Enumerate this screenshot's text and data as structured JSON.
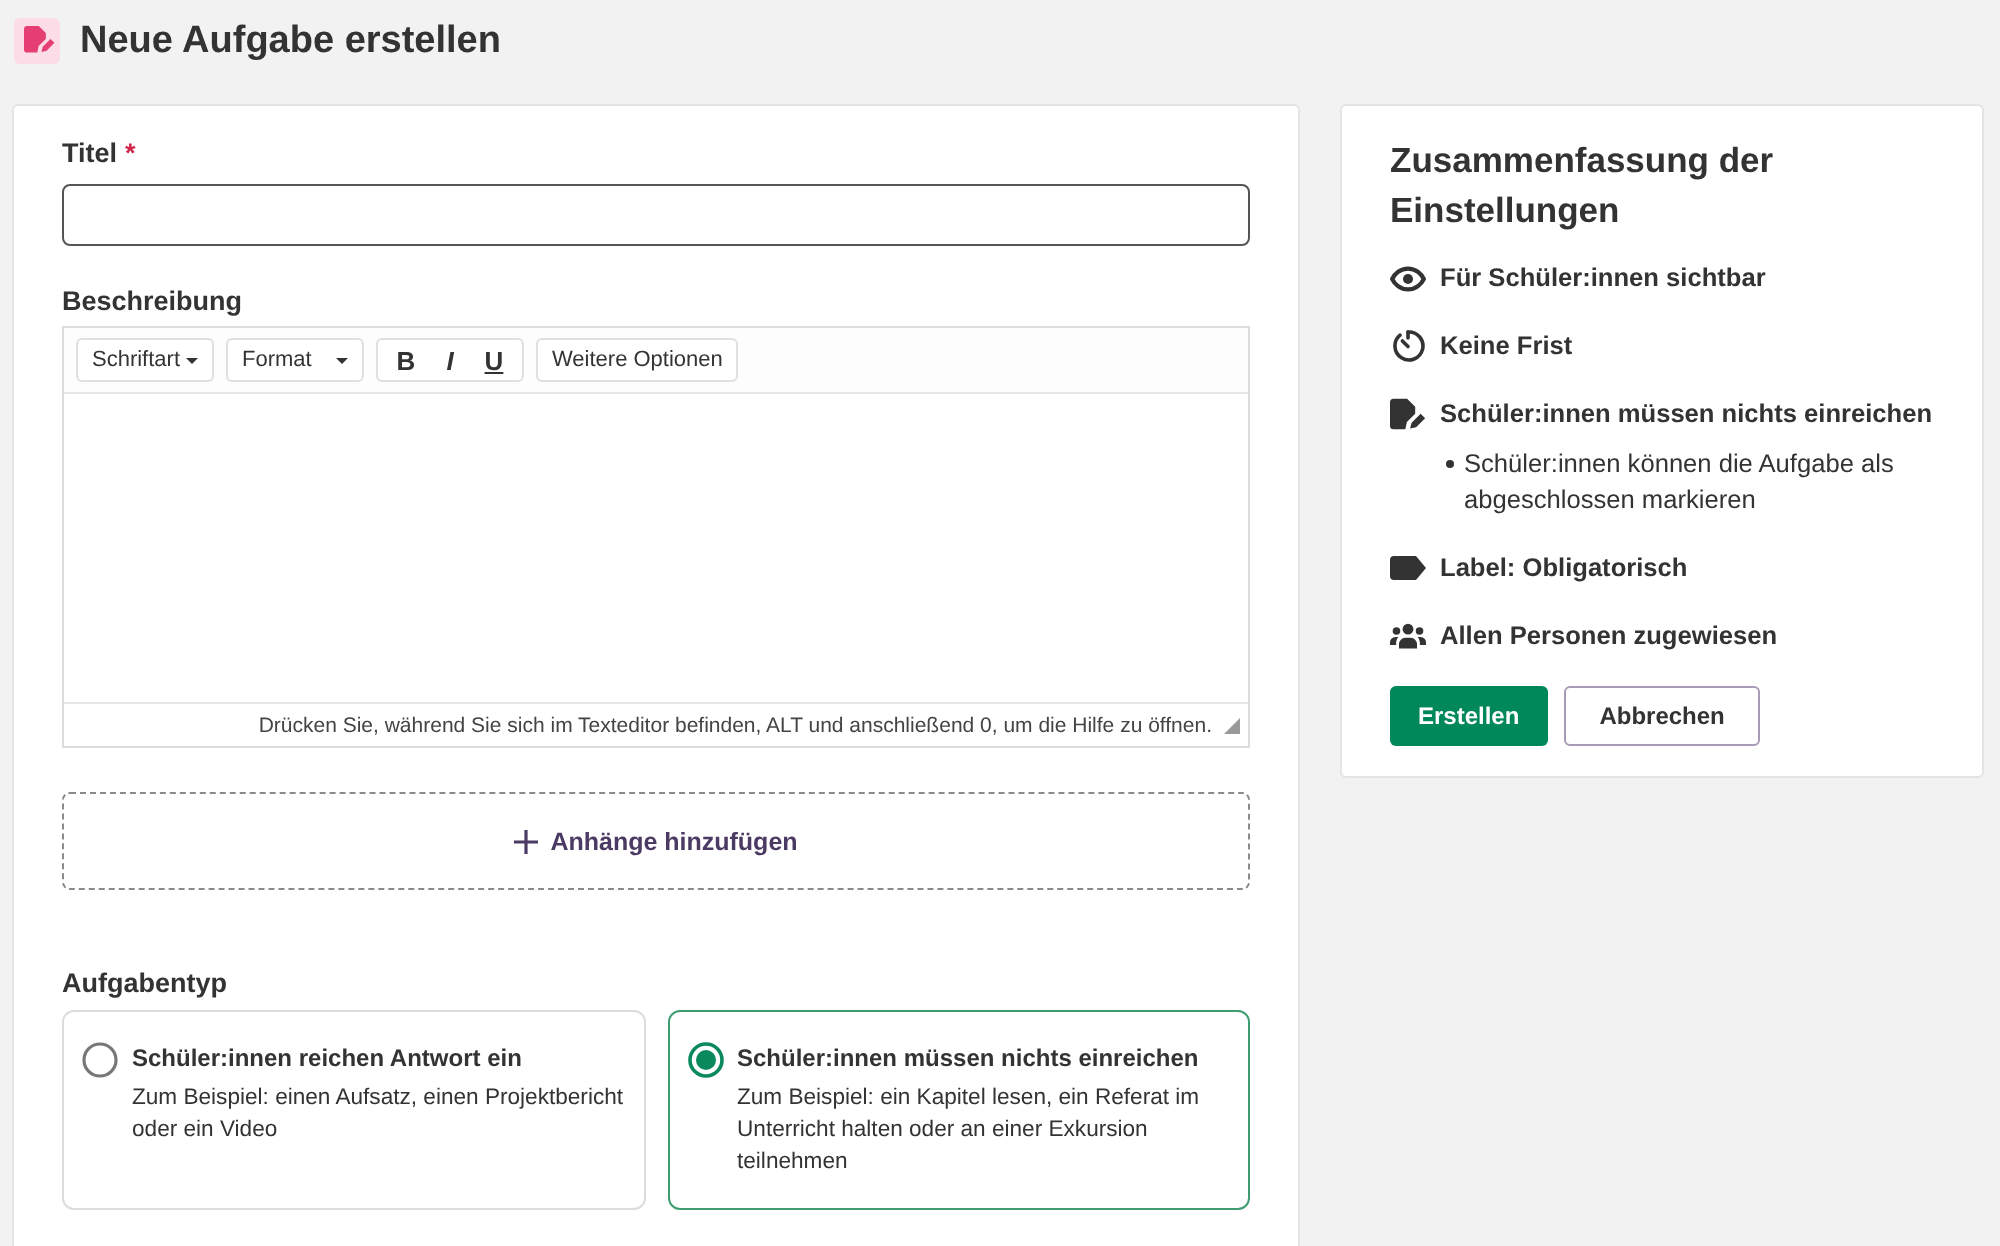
{
  "header": {
    "title": "Neue Aufgabe erstellen"
  },
  "form": {
    "title_field": {
      "label": "Titel",
      "required_mark": "*"
    },
    "description": {
      "label": "Beschreibung",
      "toolbar": [
        {
          "kind": "dropdown",
          "label": "Schriftart"
        },
        {
          "kind": "dropdown",
          "label": "Format"
        },
        {
          "kind": "group",
          "buttons": [
            {
              "kind": "bold",
              "label": "B"
            },
            {
              "kind": "italic",
              "label": "I"
            },
            {
              "kind": "underline",
              "label": "U"
            }
          ]
        },
        {
          "kind": "button",
          "label": "Weitere Optionen"
        }
      ],
      "help_text": "Drücken Sie, während Sie sich im Texteditor befinden, ALT und anschließend 0, um die Hilfe zu öffnen."
    },
    "attachments": {
      "label": "Anhänge hinzufügen"
    },
    "task_type": {
      "label": "Aufgabentyp",
      "options": [
        {
          "title": "Schüler:innen reichen Antwort ein",
          "description": "Zum Beispiel: einen Aufsatz, einen Projektbericht oder ein Video",
          "selected": false
        },
        {
          "title": "Schüler:innen müssen nichts einreichen",
          "description": "Zum Beispiel: ein Kapitel lesen, ein Referat im Unterricht halten oder an einer Exkursion teilnehmen",
          "selected": true
        }
      ]
    }
  },
  "summary": {
    "title": "Zusammenfassung der Einstellungen",
    "items": [
      {
        "kind": "visibility",
        "text": "Für Schüler:innen sichtbar"
      },
      {
        "kind": "deadline",
        "text": "Keine Frist"
      },
      {
        "kind": "submission",
        "text": "Schüler:innen müssen nichts einreichen",
        "bullets": [
          "Schüler:innen können die Aufgabe als abgeschlossen markieren"
        ]
      },
      {
        "kind": "label",
        "text": "Label: Obligatorisch"
      },
      {
        "kind": "assignees",
        "text": "Allen Personen zugewiesen"
      }
    ],
    "buttons": [
      {
        "kind": "primary",
        "label": "Erstellen"
      },
      {
        "kind": "secondary",
        "label": "Abbrechen"
      }
    ]
  }
}
